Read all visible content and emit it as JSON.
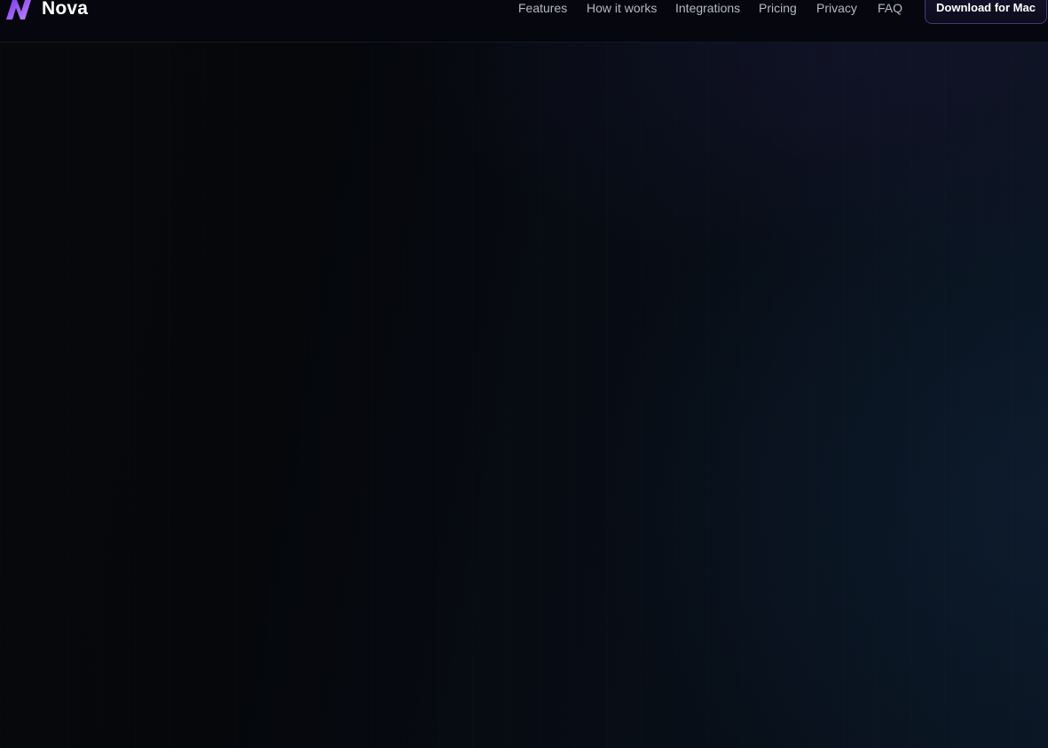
{
  "brand": {
    "name": "Nova",
    "logo_icon": "nova-n-logo-icon",
    "logo_color_start": "#7c3aed",
    "logo_color_end": "#c084fc"
  },
  "nav": {
    "items": [
      {
        "label": "Features"
      },
      {
        "label": "How it works"
      },
      {
        "label": "Integrations"
      },
      {
        "label": "Pricing"
      },
      {
        "label": "Privacy"
      },
      {
        "label": "FAQ"
      }
    ],
    "cta_label": "Download for Mac"
  },
  "colors": {
    "background": "#05070b",
    "header_bg": "#06070e",
    "nav_text": "#b4b8c6",
    "cta_border": "#4a3580"
  }
}
